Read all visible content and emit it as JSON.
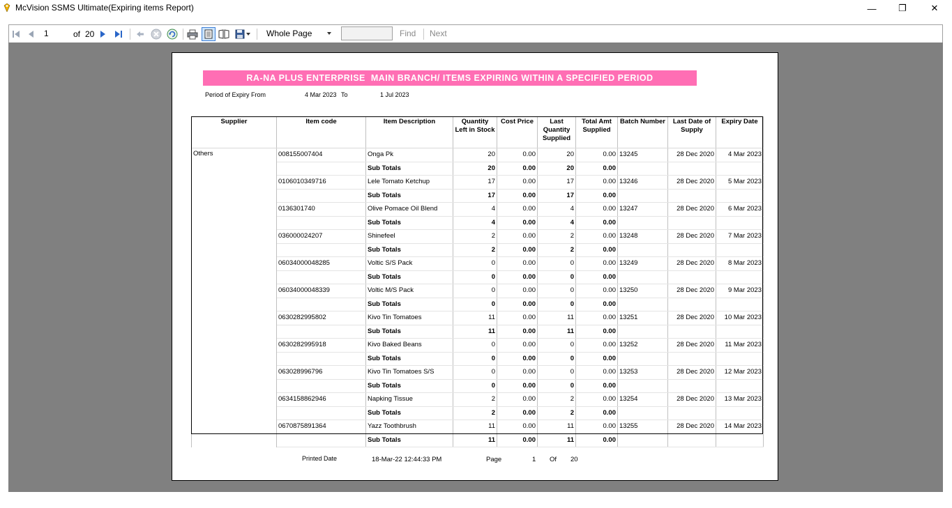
{
  "window": {
    "title": "McVision SSMS Ultimate(Expiring items Report)",
    "minimize_glyph": "—",
    "maximize_glyph": "❐",
    "close_glyph": "✕"
  },
  "toolbar": {
    "page_current": "1",
    "page_of_label": "of",
    "page_total": "20",
    "zoom": "Whole Page",
    "find_label": "Find",
    "next_label": "Next"
  },
  "report": {
    "banner": "RA-NA PLUS ENTERPRISE  MAIN BRANCH/ ITEMS EXPIRING WITHIN A SPECIFIED PERIOD",
    "period_label": "Period of Expiry From",
    "period_from": "4 Mar 2023",
    "period_to_label": "To",
    "period_to": "1 Jul 2023",
    "columns": [
      "Supplier",
      "Item code",
      "Item Description",
      "Quantity Left in Stock",
      "Cost Price",
      "Last Quantity Supplied",
      "Total Amt Supplied",
      "Batch Number",
      "Last Date of Supply",
      "Expiry Date"
    ],
    "supplier": "Others",
    "subtotal_label": "Sub Totals",
    "items": [
      {
        "code": "008155007404",
        "desc": "Onga Pk",
        "qty": "20",
        "cost": "0.00",
        "last_qty": "20",
        "total": "0.00",
        "batch": "13245",
        "last_date": "28 Dec 2020",
        "expiry": "4 Mar 2023",
        "sub_qty": "20",
        "sub_cost": "0.00",
        "sub_last": "20",
        "sub_total": "0.00"
      },
      {
        "code": "0106010349716",
        "desc": "Lele Tomato Ketchup",
        "qty": "17",
        "cost": "0.00",
        "last_qty": "17",
        "total": "0.00",
        "batch": "13246",
        "last_date": "28 Dec 2020",
        "expiry": "5 Mar 2023",
        "sub_qty": "17",
        "sub_cost": "0.00",
        "sub_last": "17",
        "sub_total": "0.00"
      },
      {
        "code": "0136301740",
        "desc": "Olive Pomace Oil Blend",
        "qty": "4",
        "cost": "0.00",
        "last_qty": "4",
        "total": "0.00",
        "batch": "13247",
        "last_date": "28 Dec 2020",
        "expiry": "6 Mar 2023",
        "sub_qty": "4",
        "sub_cost": "0.00",
        "sub_last": "4",
        "sub_total": "0.00"
      },
      {
        "code": "036000024207",
        "desc": "Shinefeel",
        "qty": "2",
        "cost": "0.00",
        "last_qty": "2",
        "total": "0.00",
        "batch": "13248",
        "last_date": "28 Dec 2020",
        "expiry": "7 Mar 2023",
        "sub_qty": "2",
        "sub_cost": "0.00",
        "sub_last": "2",
        "sub_total": "0.00"
      },
      {
        "code": "06034000048285",
        "desc": "Voltic S/S Pack",
        "qty": "0",
        "cost": "0.00",
        "last_qty": "0",
        "total": "0.00",
        "batch": "13249",
        "last_date": "28 Dec 2020",
        "expiry": "8 Mar 2023",
        "sub_qty": "0",
        "sub_cost": "0.00",
        "sub_last": "0",
        "sub_total": "0.00"
      },
      {
        "code": "06034000048339",
        "desc": "Voltic M/S Pack",
        "qty": "0",
        "cost": "0.00",
        "last_qty": "0",
        "total": "0.00",
        "batch": "13250",
        "last_date": "28 Dec 2020",
        "expiry": "9 Mar 2023",
        "sub_qty": "0",
        "sub_cost": "0.00",
        "sub_last": "0",
        "sub_total": "0.00"
      },
      {
        "code": "0630282995802",
        "desc": "Kivo Tin Tomatoes",
        "qty": "11",
        "cost": "0.00",
        "last_qty": "11",
        "total": "0.00",
        "batch": "13251",
        "last_date": "28 Dec 2020",
        "expiry": "10 Mar 2023",
        "sub_qty": "11",
        "sub_cost": "0.00",
        "sub_last": "11",
        "sub_total": "0.00"
      },
      {
        "code": "0630282995918",
        "desc": "Kivo Baked Beans",
        "qty": "0",
        "cost": "0.00",
        "last_qty": "0",
        "total": "0.00",
        "batch": "13252",
        "last_date": "28 Dec 2020",
        "expiry": "11 Mar 2023",
        "sub_qty": "0",
        "sub_cost": "0.00",
        "sub_last": "0",
        "sub_total": "0.00"
      },
      {
        "code": "063028996796",
        "desc": "Kivo Tin Tomatoes S/S",
        "qty": "0",
        "cost": "0.00",
        "last_qty": "0",
        "total": "0.00",
        "batch": "13253",
        "last_date": "28 Dec 2020",
        "expiry": "12 Mar 2023",
        "sub_qty": "0",
        "sub_cost": "0.00",
        "sub_last": "0",
        "sub_total": "0.00"
      },
      {
        "code": "0634158862946",
        "desc": "Napking Tissue",
        "qty": "2",
        "cost": "0.00",
        "last_qty": "2",
        "total": "0.00",
        "batch": "13254",
        "last_date": "28 Dec 2020",
        "expiry": "13 Mar 2023",
        "sub_qty": "2",
        "sub_cost": "0.00",
        "sub_last": "2",
        "sub_total": "0.00"
      },
      {
        "code": "0670875891364",
        "desc": "Yazz Toothbrush",
        "qty": "11",
        "cost": "0.00",
        "last_qty": "11",
        "total": "0.00",
        "batch": "13255",
        "last_date": "28 Dec 2020",
        "expiry": "14 Mar 2023",
        "sub_qty": "11",
        "sub_cost": "0.00",
        "sub_last": "11",
        "sub_total": "0.00"
      }
    ],
    "footer": {
      "printed_label": "Printed Date",
      "printed_date": "18-Mar-22 12:44:33 PM",
      "page_label": "Page",
      "page_num": "1",
      "of_label": "Of",
      "page_total": "20"
    }
  }
}
